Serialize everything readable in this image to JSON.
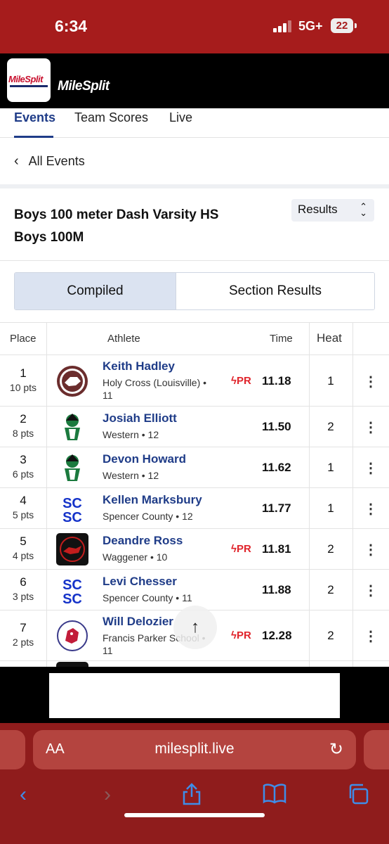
{
  "status_bar": {
    "time": "6:34",
    "network": "5G+",
    "battery": "22"
  },
  "brand": {
    "logo_text": "MileSplit",
    "name": "MileSplit"
  },
  "tabs": [
    {
      "label": "Events",
      "active": true
    },
    {
      "label": "Team Scores",
      "active": false
    },
    {
      "label": "Live",
      "active": false
    }
  ],
  "back_link": "All Events",
  "event_title": "Boys 100 meter Dash Varsity HS Boys 100M",
  "view_select": "Results",
  "segments": [
    {
      "label": "Compiled",
      "selected": true
    },
    {
      "label": "Section Results",
      "selected": false
    }
  ],
  "columns": {
    "place": "Place",
    "athlete": "Athlete",
    "time": "Time",
    "heat": "Heat"
  },
  "pr_label": "PR",
  "rows": [
    {
      "place": "1",
      "points": "10 pts",
      "name": "Keith Hadley",
      "team": "Holy Cross (Louisville) • 11",
      "pr": true,
      "time": "11.18",
      "heat": "1",
      "logo": "holy-cross-logo"
    },
    {
      "place": "2",
      "points": "8 pts",
      "name": "Josiah Elliott",
      "team": "Western • 12",
      "pr": false,
      "time": "11.50",
      "heat": "2",
      "logo": "western-logo"
    },
    {
      "place": "3",
      "points": "6 pts",
      "name": "Devon Howard",
      "team": "Western • 12",
      "pr": false,
      "time": "11.62",
      "heat": "1",
      "logo": "western-logo"
    },
    {
      "place": "4",
      "points": "5 pts",
      "name": "Kellen Marksbury",
      "team": "Spencer County • 12",
      "pr": false,
      "time": "11.77",
      "heat": "1",
      "logo": "spencer-county-logo"
    },
    {
      "place": "5",
      "points": "4 pts",
      "name": "Deandre Ross",
      "team": "Waggener • 10",
      "pr": true,
      "time": "11.81",
      "heat": "2",
      "logo": "waggener-logo"
    },
    {
      "place": "6",
      "points": "3 pts",
      "name": "Levi Chesser",
      "team": "Spencer County • 11",
      "pr": false,
      "time": "11.88",
      "heat": "2",
      "logo": "spencer-county-logo"
    },
    {
      "place": "7",
      "points": "2 pts",
      "name": "Will Delozier",
      "team": "Francis Parker School • 11",
      "pr": true,
      "time": "12.28",
      "heat": "2",
      "logo": "francis-parker-logo"
    }
  ],
  "browser": {
    "aa_label": "AA",
    "url": "milesplit.live"
  },
  "colors": {
    "status_red": "#a61c1c",
    "brand_blue": "#1f3c88",
    "pr_red": "#e0242b",
    "safari_red": "#8f1c1c",
    "toolbar_blue": "#3f8de8"
  }
}
